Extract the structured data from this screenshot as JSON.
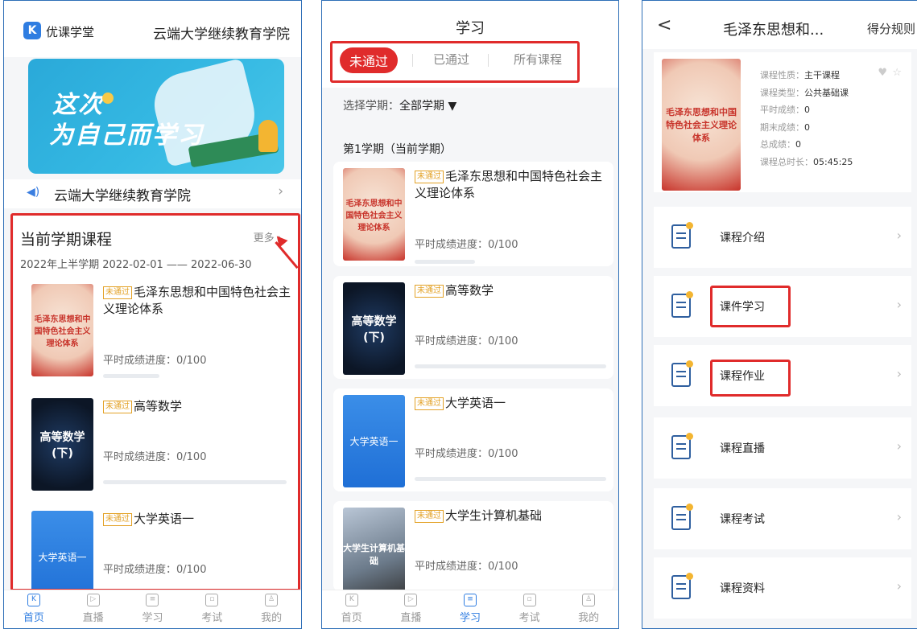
{
  "panel1": {
    "brand": "优课学堂",
    "brand_logo_letter": "K",
    "school": "云端大学继续教育学院",
    "banner": {
      "line1": "这次",
      "line2": "为自己而学习"
    },
    "notice": "云端大学继续教育学院",
    "section_title": "当前学期课程",
    "more": "更多",
    "term_range": "2022年上半学期  2022-02-01  ——  2022-06-30",
    "courses": [
      {
        "tag": "未通过",
        "title": "毛泽东思想和中国特色社会主义理论体系",
        "progress": "平时成绩进度：0/100",
        "thumb_text": "毛泽东思想和中国特色社会主义理论体系",
        "progress_value": 0
      },
      {
        "tag": "未通过",
        "title": "高等数学",
        "progress": "平时成绩进度：0/100",
        "thumb_text": "高等数学(下)",
        "progress_value": 0
      },
      {
        "tag": "未通过",
        "title": "大学英语一",
        "progress": "平时成绩进度：0/100",
        "thumb_text": "大学英语一",
        "progress_value": 0
      }
    ]
  },
  "tabbar": [
    {
      "label": "首页",
      "icon": "home-icon",
      "glyph": "K"
    },
    {
      "label": "直播",
      "icon": "live-icon",
      "glyph": "▷"
    },
    {
      "label": "学习",
      "icon": "study-icon",
      "glyph": "≡"
    },
    {
      "label": "考试",
      "icon": "exam-icon",
      "glyph": "▫"
    },
    {
      "label": "我的",
      "icon": "profile-icon",
      "glyph": "♙"
    }
  ],
  "panel1_active_tab": "首页",
  "panel2": {
    "title": "学习",
    "tabs": [
      "未通过",
      "已通过",
      "所有课程"
    ],
    "active_tab": "未通过",
    "term_select_label": "选择学期：",
    "term_select_value": "全部学期 ▼",
    "term_label": "第1学期（当前学期）",
    "courses": [
      {
        "tag": "未通过",
        "title": "毛泽东思想和中国特色社会主义理论体系",
        "progress": "平时成绩进度：0/100",
        "thumb_text": "毛泽东思想和中国特色社会主义理论体系"
      },
      {
        "tag": "未通过",
        "title": "高等数学",
        "progress": "平时成绩进度：0/100",
        "thumb_text": "高等数学(下)"
      },
      {
        "tag": "未通过",
        "title": "大学英语一",
        "progress": "平时成绩进度：0/100",
        "thumb_text": "大学英语一"
      },
      {
        "tag": "未通过",
        "title": "大学生计算机基础",
        "progress": "平时成绩进度：0/100",
        "thumb_text": "大学生计算机基础"
      }
    ],
    "active_bottom_tab": "学习"
  },
  "panel3": {
    "back": "<",
    "title": "毛泽东思想和...",
    "rule": "得分规则",
    "thumb_text": "毛泽东思想和中国特色社会主义理论体系",
    "info": [
      {
        "k": "课程性质：",
        "v": "主干课程"
      },
      {
        "k": "课程类型：",
        "v": "公共基础课"
      },
      {
        "k": "平时成绩：",
        "v": "0"
      },
      {
        "k": "期末成绩：",
        "v": "0"
      },
      {
        "k": "总成绩：",
        "v": "0"
      },
      {
        "k": "课程总时长：",
        "v": "05:45:25"
      }
    ],
    "menu": [
      "课程介绍",
      "课件学习",
      "课程作业",
      "课程直播",
      "课程考试",
      "课程资料"
    ]
  },
  "colors": {
    "accent": "#2f7de1",
    "highlight": "#e02b2b",
    "tag": "#e3a227"
  }
}
